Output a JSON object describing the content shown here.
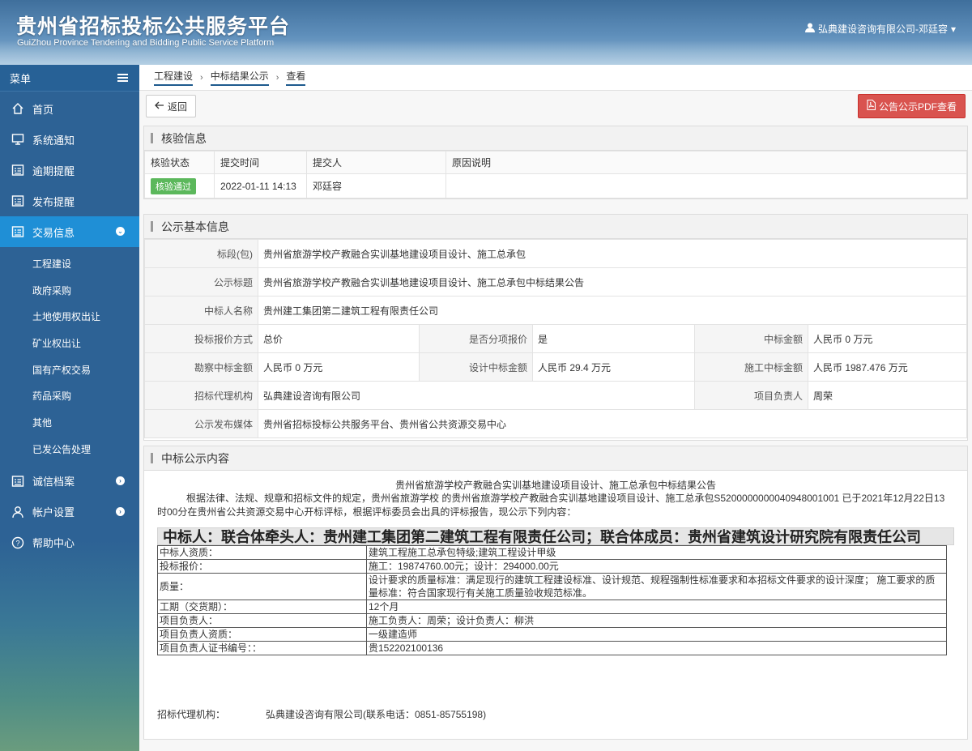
{
  "header": {
    "title": "贵州省招标投标公共服务平台",
    "subtitle": "GuiZhou Province Tendering and Bidding Public Service Platform",
    "user": "弘典建设咨询有限公司-邓廷容"
  },
  "sidebar": {
    "menu_label": "菜单",
    "items": [
      {
        "label": "首页",
        "icon": "home-icon"
      },
      {
        "label": "系统通知",
        "icon": "monitor-icon"
      },
      {
        "label": "逾期提醒",
        "icon": "list-icon"
      },
      {
        "label": "发布提醒",
        "icon": "list-icon"
      },
      {
        "label": "交易信息",
        "icon": "list-icon",
        "active": true
      }
    ],
    "sub_items": [
      "工程建设",
      "政府采购",
      "土地使用权出让",
      "矿业权出让",
      "国有产权交易",
      "药品采购",
      "其他",
      "已发公告处理"
    ],
    "bottom_items": [
      {
        "label": "诚信档案",
        "icon": "list-icon"
      },
      {
        "label": "帐户设置",
        "icon": "user-icon"
      },
      {
        "label": "帮助中心",
        "icon": "help-icon"
      }
    ]
  },
  "breadcrumb": [
    "工程建设",
    "中标结果公示",
    "查看"
  ],
  "toolbar": {
    "back_label": "返回",
    "pdf_label": "公告公示PDF查看"
  },
  "verify": {
    "title": "核验信息",
    "headers": [
      "核验状态",
      "提交时间",
      "提交人",
      "原因说明"
    ],
    "status": "核验通过",
    "time": "2022-01-11 14:13",
    "submitter": "邓廷容",
    "reason": ""
  },
  "basic": {
    "title": "公示基本信息",
    "section_label": "标段(包)",
    "section_value": "贵州省旅游学校产教融合实训基地建设项目设计、施工总承包",
    "notice_title_label": "公示标题",
    "notice_title_value": "贵州省旅游学校产教融合实训基地建设项目设计、施工总承包中标结果公告",
    "winner_label": "中标人名称",
    "winner_value": "贵州建工集团第二建筑工程有限责任公司",
    "bid_method_label": "投标报价方式",
    "bid_method_value": "总价",
    "split_label": "是否分项报价",
    "split_value": "是",
    "amount_label": "中标金额",
    "amount_value": "人民币 0 万元",
    "survey_label": "勘察中标金额",
    "survey_value": "人民币 0 万元",
    "design_label": "设计中标金额",
    "design_value": "人民币 29.4 万元",
    "construct_label": "施工中标金额",
    "construct_value": "人民币 1987.476 万元",
    "agency_label": "招标代理机构",
    "agency_value": "弘典建设咨询有限公司",
    "manager_label": "项目负责人",
    "manager_value": "周荣",
    "media_label": "公示发布媒体",
    "media_value": "贵州省招标投标公共服务平台、贵州省公共资源交易中心"
  },
  "content": {
    "title": "中标公示内容",
    "notice_title": "贵州省旅游学校产教融合实训基地建设项目设计、施工总承包中标结果公告",
    "body": "根据法律、法规、规章和招标文件的规定，贵州省旅游学校 的贵州省旅游学校产教融合实训基地建设项目设计、施工总承包S5200000000040948001001 已于2021年12月22日13时00分在贵州省公共资源交易中心开标评标，根据评标委员会出具的评标报告，现公示下列内容：",
    "winner_line": "中标人：联合体牵头人：贵州建工集团第二建筑工程有限责任公司；联合体成员：贵州省建筑设计研究院有限责任公司",
    "rows": [
      {
        "k": "中标人资质：",
        "v": "建筑工程施工总承包特级;建筑工程设计甲级"
      },
      {
        "k": "投标报价：",
        "v": "施工：19874760.00元；设计：294000.00元"
      },
      {
        "k": "质量：",
        "v": "设计要求的质量标准：满足现行的建筑工程建设标准、设计规范、规程强制性标准要求和本招标文件要求的设计深度； 施工要求的质量标准：符合国家现行有关施工质量验收规范标准。"
      },
      {
        "k": "工期（交货期）：",
        "v": "12个月"
      },
      {
        "k": "项目负责人：",
        "v": "施工负责人：周荣；设计负责人：柳洪"
      },
      {
        "k": "项目负责人资质：",
        "v": "一级建造师"
      },
      {
        "k": "项目负责人证书编号：：",
        "v": "贵152202100136"
      }
    ],
    "agency_label": "招标代理机构：",
    "agency_value": "弘典建设咨询有限公司(联系电话：0851-85755198)"
  }
}
